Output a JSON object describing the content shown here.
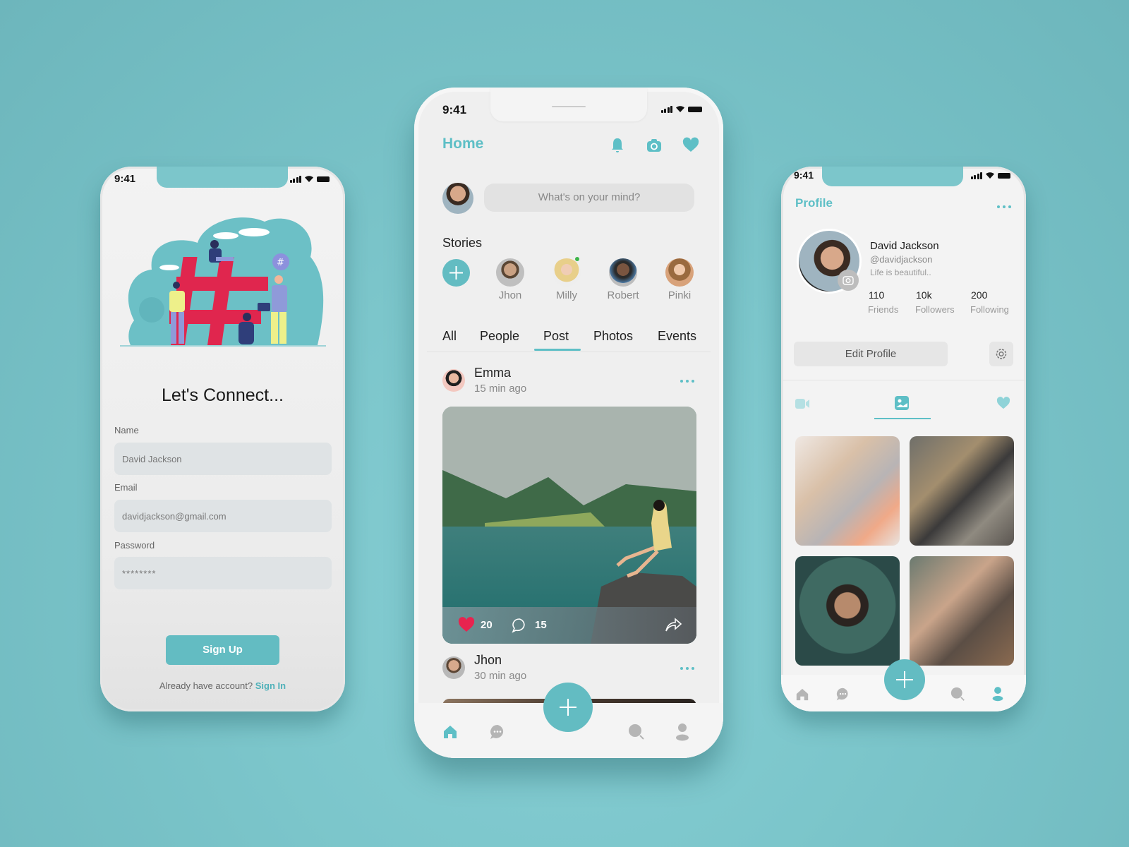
{
  "colors": {
    "background": "#7cc6cb",
    "accent": "#5ebfc6",
    "button": "#63bcc2",
    "like": "#e8234f",
    "hashtag": "#e0264e"
  },
  "left_phone": {
    "status_time": "9:41",
    "title": "Let's Connect...",
    "fields": [
      {
        "label": "Name",
        "value": "David Jackson"
      },
      {
        "label": "Email",
        "value": "davidjackson@gmail.com"
      },
      {
        "label": "Password",
        "value": "********"
      }
    ],
    "signup_label": "Sign Up",
    "account_prompt": "Already have account?",
    "signin_label": "Sign In"
  },
  "center_phone": {
    "status_time": "9:41",
    "title": "Home",
    "header_icons": [
      "bell-icon",
      "camera-icon",
      "heart-icon"
    ],
    "composer_placeholder": "What's on your mind?",
    "stories_title": "Stories",
    "stories": [
      {
        "name": "Jhon",
        "online": false
      },
      {
        "name": "Milly",
        "online": true
      },
      {
        "name": "Robert",
        "online": false
      },
      {
        "name": "Pinki",
        "online": false
      }
    ],
    "tabs": [
      {
        "label": "All",
        "active": false
      },
      {
        "label": "People",
        "active": false
      },
      {
        "label": "Post",
        "active": true
      },
      {
        "label": "Photos",
        "active": false
      },
      {
        "label": "Events",
        "active": false
      }
    ],
    "posts": [
      {
        "author": "Emma",
        "time": "15 min ago",
        "likes": "20",
        "comments": "15"
      },
      {
        "author": "Jhon",
        "time": "30 min ago"
      }
    ],
    "nav": [
      "home-icon",
      "chat-icon",
      "add-icon",
      "search-icon",
      "profile-icon"
    ]
  },
  "right_phone": {
    "status_time": "9:41",
    "title": "Profile",
    "name": "David Jackson",
    "handle": "@davidjackson",
    "bio": "Life is beautiful..",
    "stats": [
      {
        "value": "110",
        "label": "Friends"
      },
      {
        "value": "10k",
        "label": "Followers"
      },
      {
        "value": "200",
        "label": "Following"
      }
    ],
    "edit_label": "Edit Profile",
    "media_tabs": [
      "video-icon",
      "image-icon",
      "heart-icon"
    ],
    "active_media_tab": "image-icon",
    "grid_photos": [
      "wedding-hands-photo",
      "cafe-dog-photo",
      "swimmer-photo",
      "coworkers-laptop-photo"
    ]
  }
}
